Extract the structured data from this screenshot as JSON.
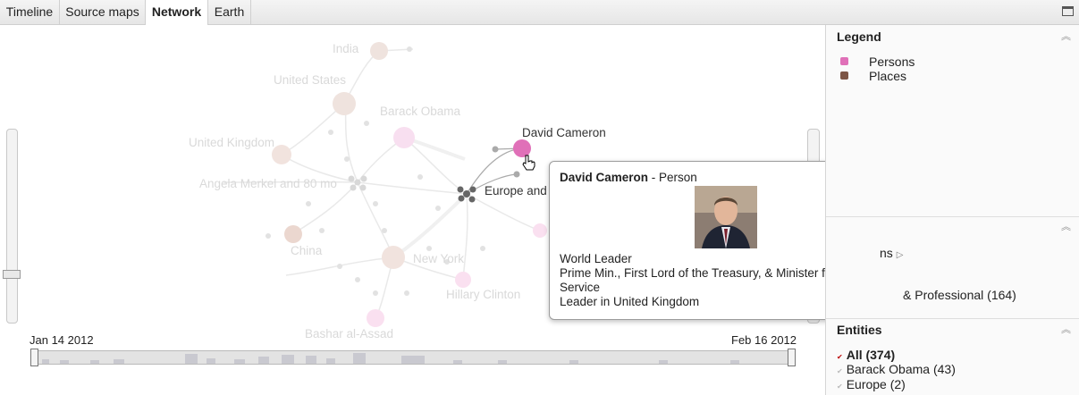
{
  "tabs": [
    {
      "label": "Timeline",
      "active": false
    },
    {
      "label": "Source maps",
      "active": false
    },
    {
      "label": "Network",
      "active": true
    },
    {
      "label": "Earth",
      "active": false
    }
  ],
  "graph": {
    "nodes": [
      {
        "label": "India",
        "color": "#e8dcd6"
      },
      {
        "label": "United States",
        "color": "#e8dcd6"
      },
      {
        "label": "Barack Obama",
        "color": "#f6dcec"
      },
      {
        "label": "United Kingdom",
        "color": "#ecdcd6"
      },
      {
        "label": "Angela Merkel and 80 mo",
        "color": "#cfcfcf"
      },
      {
        "label": "David Cameron",
        "color": "#e070b8"
      },
      {
        "label": "Europe and",
        "color": "#555555"
      },
      {
        "label": "China",
        "color": "#e6d4cc"
      },
      {
        "label": "New York",
        "color": "#ecdcd6"
      },
      {
        "label": "Hillary Clinton",
        "color": "#f8dcec"
      },
      {
        "label": "Bashar al-Assad",
        "color": "#f8dcec"
      }
    ]
  },
  "timeline": {
    "start": "Jan 14 2012",
    "end": "Feb 16 2012"
  },
  "tooltip": {
    "name": "David Cameron",
    "type": " - Person",
    "lines": [
      "World Leader",
      "Prime Min., First Lord of the Treasury, & Minister for the Civil Service",
      "Leader in United Kingdom"
    ]
  },
  "panel": {
    "legend": {
      "title": "Legend",
      "items": [
        {
          "label": "Persons",
          "color": "#e070b8"
        },
        {
          "label": "Places",
          "color": "#7d5545"
        }
      ]
    },
    "facet": {
      "partial_line1": "ns",
      "partial_line2": "& Professional (164)"
    },
    "entities": {
      "title": "Entities",
      "items": [
        {
          "label": "All (374)",
          "bold": true,
          "checked": true
        },
        {
          "label": "Barack Obama (43)",
          "bold": false,
          "checked": false
        },
        {
          "label": "Europe (2)",
          "bold": false,
          "checked": false
        }
      ]
    }
  },
  "icons": {
    "maximize": "maximize-icon",
    "collapse": "collapse-up-icon",
    "cursor": "hand-pointer-icon"
  }
}
